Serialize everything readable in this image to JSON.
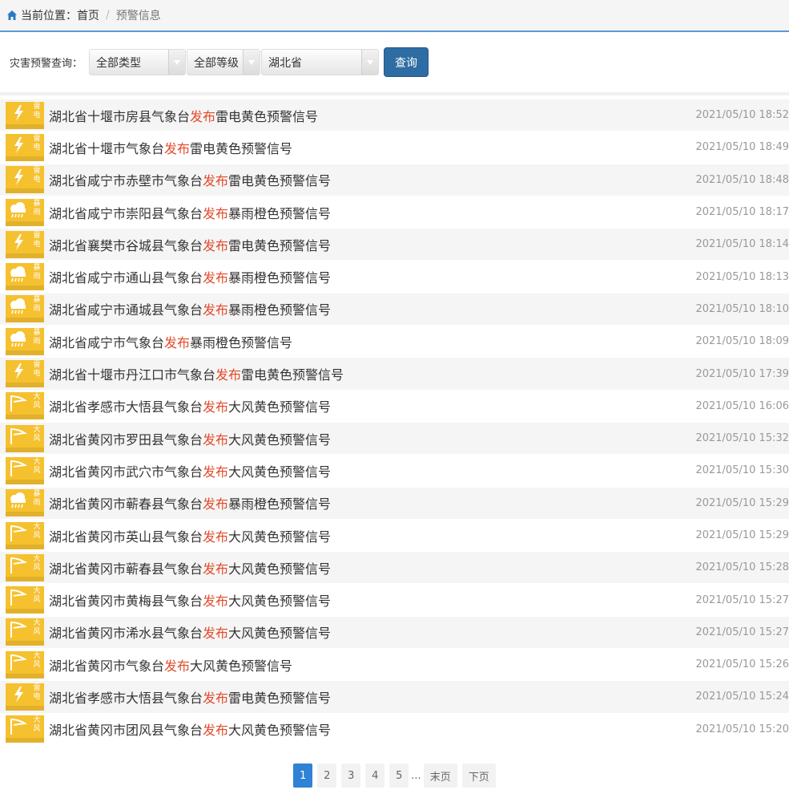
{
  "breadcrumb": {
    "prefix": "当前位置：",
    "home": "首页",
    "separator": "/",
    "current": "预警信息"
  },
  "filter": {
    "label": "灾害预警查询：",
    "type_select": "全部类型",
    "level_select": "全部等级",
    "region_select": "湖北省",
    "query_button": "查询"
  },
  "colors": {
    "accent": "#2e6da4",
    "highlight": "#e34a2a",
    "icon_bg": "#f6c12f"
  },
  "items": [
    {
      "pre": "湖北省十堰市房县气象台",
      "hl": "发布",
      "post": "雷电黄色预警信号",
      "time": "2021/05/10 18:52",
      "icon": "lightning-icon",
      "k1": "雷",
      "k2": "电"
    },
    {
      "pre": "湖北省十堰市气象台",
      "hl": "发布",
      "post": "雷电黄色预警信号",
      "time": "2021/05/10 18:49",
      "icon": "lightning-icon",
      "k1": "雷",
      "k2": "电"
    },
    {
      "pre": "湖北省咸宁市赤壁市气象台",
      "hl": "发布",
      "post": "雷电黄色预警信号",
      "time": "2021/05/10 18:48",
      "icon": "lightning-icon",
      "k1": "雷",
      "k2": "电"
    },
    {
      "pre": "湖北省咸宁市崇阳县气象台",
      "hl": "发布",
      "post": "暴雨橙色预警信号",
      "time": "2021/05/10 18:17",
      "icon": "rainstorm-icon",
      "k1": "暴",
      "k2": "雨"
    },
    {
      "pre": "湖北省襄樊市谷城县气象台",
      "hl": "发布",
      "post": "雷电黄色预警信号",
      "time": "2021/05/10 18:14",
      "icon": "lightning-icon",
      "k1": "雷",
      "k2": "电"
    },
    {
      "pre": "湖北省咸宁市通山县气象台",
      "hl": "发布",
      "post": "暴雨橙色预警信号",
      "time": "2021/05/10 18:13",
      "icon": "rainstorm-icon",
      "k1": "暴",
      "k2": "雨"
    },
    {
      "pre": "湖北省咸宁市通城县气象台",
      "hl": "发布",
      "post": "暴雨橙色预警信号",
      "time": "2021/05/10 18:10",
      "icon": "rainstorm-icon",
      "k1": "暴",
      "k2": "雨"
    },
    {
      "pre": "湖北省咸宁市气象台",
      "hl": "发布",
      "post": "暴雨橙色预警信号",
      "time": "2021/05/10 18:09",
      "icon": "rainstorm-icon",
      "k1": "暴",
      "k2": "雨"
    },
    {
      "pre": "湖北省十堰市丹江口市气象台",
      "hl": "发布",
      "post": "雷电黄色预警信号",
      "time": "2021/05/10 17:39",
      "icon": "lightning-icon",
      "k1": "雷",
      "k2": "电"
    },
    {
      "pre": "湖北省孝感市大悟县气象台",
      "hl": "发布",
      "post": "大风黄色预警信号",
      "time": "2021/05/10 16:06",
      "icon": "gale-icon",
      "k1": "大",
      "k2": "风"
    },
    {
      "pre": "湖北省黄冈市罗田县气象台",
      "hl": "发布",
      "post": "大风黄色预警信号",
      "time": "2021/05/10 15:32",
      "icon": "gale-icon",
      "k1": "大",
      "k2": "风"
    },
    {
      "pre": "湖北省黄冈市武穴市气象台",
      "hl": "发布",
      "post": "大风黄色预警信号",
      "time": "2021/05/10 15:30",
      "icon": "gale-icon",
      "k1": "大",
      "k2": "风"
    },
    {
      "pre": "湖北省黄冈市蕲春县气象台",
      "hl": "发布",
      "post": "暴雨橙色预警信号",
      "time": "2021/05/10 15:29",
      "icon": "rainstorm-icon",
      "k1": "暴",
      "k2": "雨"
    },
    {
      "pre": "湖北省黄冈市英山县气象台",
      "hl": "发布",
      "post": "大风黄色预警信号",
      "time": "2021/05/10 15:29",
      "icon": "gale-icon",
      "k1": "大",
      "k2": "风"
    },
    {
      "pre": "湖北省黄冈市蕲春县气象台",
      "hl": "发布",
      "post": "大风黄色预警信号",
      "time": "2021/05/10 15:28",
      "icon": "gale-icon",
      "k1": "大",
      "k2": "风"
    },
    {
      "pre": "湖北省黄冈市黄梅县气象台",
      "hl": "发布",
      "post": "大风黄色预警信号",
      "time": "2021/05/10 15:27",
      "icon": "gale-icon",
      "k1": "大",
      "k2": "风"
    },
    {
      "pre": "湖北省黄冈市浠水县气象台",
      "hl": "发布",
      "post": "大风黄色预警信号",
      "time": "2021/05/10 15:27",
      "icon": "gale-icon",
      "k1": "大",
      "k2": "风"
    },
    {
      "pre": "湖北省黄冈市气象台",
      "hl": "发布",
      "post": "大风黄色预警信号",
      "time": "2021/05/10 15:26",
      "icon": "gale-icon",
      "k1": "大",
      "k2": "风"
    },
    {
      "pre": "湖北省孝感市大悟县气象台",
      "hl": "发布",
      "post": "雷电黄色预警信号",
      "time": "2021/05/10 15:24",
      "icon": "lightning-icon",
      "k1": "雷",
      "k2": "电"
    },
    {
      "pre": "湖北省黄冈市团风县气象台",
      "hl": "发布",
      "post": "大风黄色预警信号",
      "time": "2021/05/10 15:20",
      "icon": "gale-icon",
      "k1": "大",
      "k2": "风"
    }
  ],
  "pagination": {
    "pages": [
      "1",
      "2",
      "3",
      "4",
      "5"
    ],
    "current": "1",
    "ellipsis": "...",
    "last": "末页",
    "next": "下页"
  }
}
